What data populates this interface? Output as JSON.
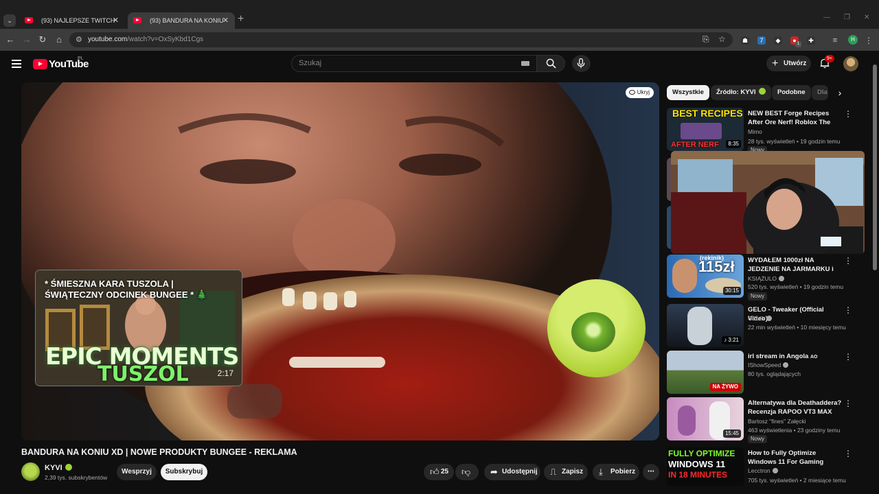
{
  "browser": {
    "tabs": [
      {
        "title": "(93) NAJLEPSZE TWITCH SZOTY",
        "active": false
      },
      {
        "title": "(93) BANDURA NA KONIU XD |",
        "active": true
      }
    ],
    "url_host": "youtube.com",
    "url_path": "/watch?v=OxSyKbd1Cgs",
    "profile_initial": "H",
    "ext_notification": "1"
  },
  "youtube": {
    "logo": "YouTube",
    "country": "PL",
    "search_placeholder": "Szukaj",
    "create_label": "Utwórz",
    "notif_badge": "9+"
  },
  "player": {
    "hide_label": "Ukryj",
    "endcard": {
      "title": "* ŚMIESZNA KARA TUSZOLA | ŚWIĄTECZNY ODCINEK BUNGEE * 🎄",
      "line1": "EPIC MOMENTS",
      "line2": "TUSZOL",
      "duration": "2:17"
    }
  },
  "video": {
    "title": "BANDURA NA KONIU XD | NOWE PRODUKTY BUNGEE - REKLAMA",
    "channel": "KYVI",
    "subscribers": "2,39 tys. subskrybentów",
    "support_label": "Wesprzyj",
    "subscribe_label": "Subskrybuj",
    "likes": "25",
    "share_label": "Udostępnij",
    "save_label": "Zapisz",
    "download_label": "Pobierz"
  },
  "chips": [
    "Wszystkie",
    "Źródło: KYVI",
    "Podobne",
    "Dla"
  ],
  "recommendations": [
    {
      "title": "NEW BEST Forge Recipes After Ore Nerf! Roblox The Forge ...",
      "channel": "Mimo",
      "meta": "28 tys. wyświetleń • 19 godzin temu",
      "duration": "8:35",
      "badge": "Nowy",
      "thumb_text": "BEST RECIPES",
      "thumb_text2": "AFTER NERF"
    },
    {
      "title": "WYDAŁEM 1000zł NA JEDZENIE NA JARMARKU i źle...",
      "channel": "KSIĄŻULO",
      "meta": "520 tys. wyświetleń • 19 godzin temu",
      "duration": "30:15",
      "badge": "Nowy",
      "thumb_text": "115zł",
      "thumb_text2": "(rekinik)"
    },
    {
      "title": "GELO - Tweaker (Official Video)",
      "channel": "GELO",
      "meta": "22 min wyświetleń • 10 miesięcy temu",
      "duration": "3:21"
    },
    {
      "title": "irl stream in Angola",
      "title_suffix": "AO",
      "channel": "IShowSpeed",
      "meta": "80 tys. oglądających",
      "live": "NA ŻYWO"
    },
    {
      "title": "Alternatywa dla Deathaddera? Recenzja RAPOO VT3 MAX",
      "channel": "Bartosz \"fines\" Załęcki",
      "meta": "463 wyświetlenia • 23 godziny temu",
      "duration": "15:45",
      "badge": "Nowy"
    },
    {
      "title": "How to Fully Optimize Windows 11 For Gaming",
      "channel": "Lecctron",
      "meta": "705 tys. wyświetleń • 2 miesiące temu",
      "thumb_text": "FULLY OPTIMIZE",
      "thumb_text2": "WINDOWS 11",
      "thumb_text3": "IN 18 MINUTES"
    }
  ]
}
